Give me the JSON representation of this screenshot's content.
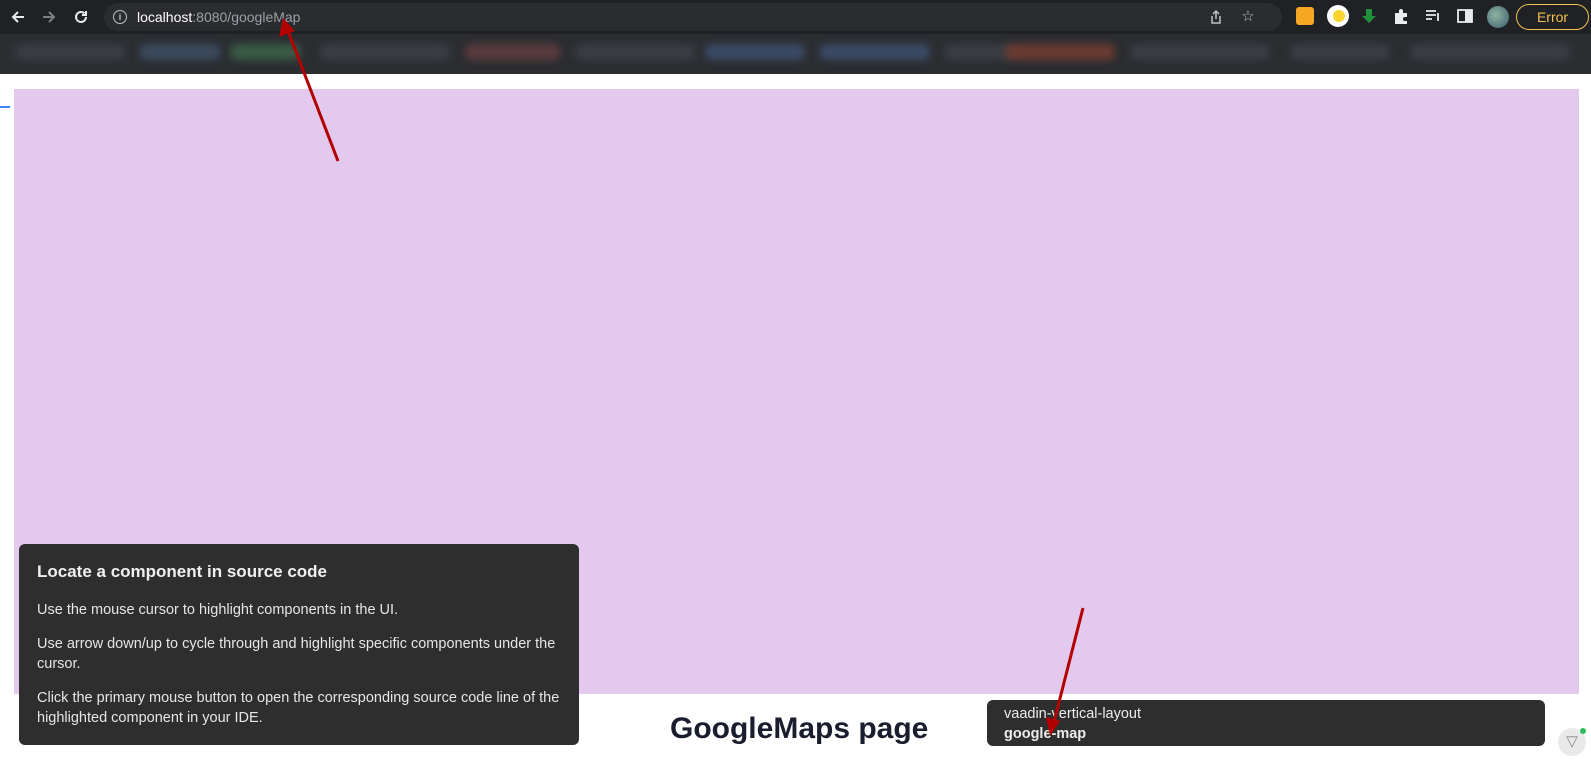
{
  "browser": {
    "url_host": "localhost",
    "url_path": ":8080/googleMap",
    "error_label": "Error",
    "icons": {
      "back": "arrow-left",
      "forward": "arrow-right",
      "reload": "reload",
      "info": "info",
      "share": "share",
      "bookmark": "star",
      "extensions": "puzzle",
      "reading_list": "list",
      "side_panel": "side-panel",
      "profile": "avatar"
    }
  },
  "page": {
    "title": "GoogleMaps page",
    "map_color": "#e3c9ee"
  },
  "help_panel": {
    "title": "Locate a component in source code",
    "line1": "Use the mouse cursor to highlight components in the UI.",
    "line2": "Use arrow down/up to cycle through and highlight specific components under the cursor.",
    "line3": "Click the primary mouse button to open the corresponding source code line of the highlighted component in your IDE."
  },
  "component_tooltip": {
    "parent": "vaadin-vertical-layout",
    "current": "google-map"
  },
  "annotation_color": "#cc0000"
}
